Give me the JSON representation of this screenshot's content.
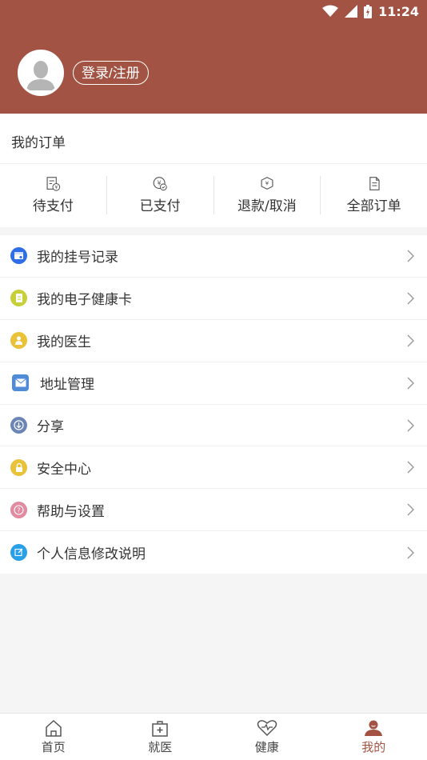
{
  "status_bar": {
    "time": "11:24"
  },
  "profile": {
    "login_label": "登录/注册"
  },
  "orders": {
    "title": "我的订单",
    "items": [
      {
        "label": "待支付",
        "icon": "pending-payment-icon"
      },
      {
        "label": "已支付",
        "icon": "paid-icon"
      },
      {
        "label": "退款/取消",
        "icon": "refund-icon"
      },
      {
        "label": "全部订单",
        "icon": "all-orders-icon"
      }
    ]
  },
  "menu": {
    "items": [
      {
        "label": "我的挂号记录",
        "icon": "registration-icon",
        "color": "#2f6ee6"
      },
      {
        "label": "我的电子健康卡",
        "icon": "health-card-icon",
        "color": "#c7cf3a"
      },
      {
        "label": "我的医生",
        "icon": "doctor-icon",
        "color": "#e9c23a"
      },
      {
        "label": "地址管理",
        "icon": "address-icon",
        "color": "#4f8bd6"
      },
      {
        "label": "分享",
        "icon": "share-icon",
        "color": "#6b86b5"
      },
      {
        "label": "安全中心",
        "icon": "lock-icon",
        "color": "#e9c23a"
      },
      {
        "label": "帮助与设置",
        "icon": "help-icon",
        "color": "#e08ba0"
      },
      {
        "label": "个人信息修改说明",
        "icon": "edit-icon",
        "color": "#27a0e8"
      }
    ]
  },
  "tabbar": {
    "items": [
      {
        "label": "首页",
        "icon": "home-icon"
      },
      {
        "label": "就医",
        "icon": "medical-kit-icon"
      },
      {
        "label": "健康",
        "icon": "heart-pulse-icon"
      },
      {
        "label": "我的",
        "icon": "user-icon",
        "active": true
      }
    ]
  },
  "colors": {
    "primary": "#a35343",
    "background": "#f5f5f5"
  }
}
